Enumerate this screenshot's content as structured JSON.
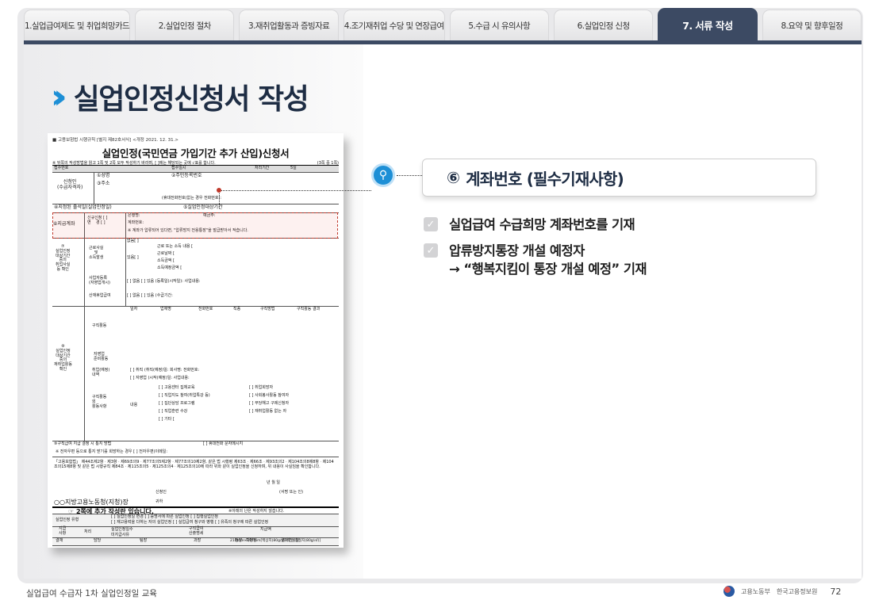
{
  "tabs": [
    {
      "label": "1.실업급여제도 및 취업희망카드"
    },
    {
      "label": "2.실업인정 절차"
    },
    {
      "label": "3.재취업활동과 증빙자료"
    },
    {
      "label": "4.조기재취업 수당 및 연장급여"
    },
    {
      "label": "5.수급 시 유의사항"
    },
    {
      "label": "6.실업인정 신청"
    },
    {
      "label": "7. 서류 작성",
      "active": true
    },
    {
      "label": "8.요약 및 향후일정"
    }
  ],
  "page_title": "실업인정신청서 작성",
  "form": {
    "header_note": "■ 고용보험법 시행규칙 [별지 제82호서식] <개정 2021. 12. 31.>",
    "title": "실업인정(국민연금 가입기간 추가 산입)신청서",
    "subnote": "※ 뒤쪽의 작성방법을 읽고 1쪽 및 2쪽 모두 작성하기 바라며, [ ]에는 해당되는 곳에 √표를 합니다.",
    "page_count": "(3쪽 중 1쪽)",
    "receipt_no": "접수번호",
    "receipt_date": "접수일시",
    "process_period_label": "처리기간",
    "process_period": "5일",
    "applicant": "신청인\n(수급자격자)",
    "name": "①성명",
    "resident_no": "②주민등록번호",
    "address": "③주소",
    "phone": "(휴대전화번호(없는 경우 전화번호):",
    "designated_date": "④지정된 출석일(실업인정일)",
    "period": "⑤실업인정대상기간",
    "account_label": "⑥지급계좌",
    "account_new": "신규신청 [ ]\n변    경 [ ]",
    "bank": "은행명:",
    "holder": "예금주:",
    "account_no": "계좌번호:",
    "account_note": "※ 계좌가 압류되어 있다면, \"압류방지 전용통장\"을 발급받아서 적습니다.",
    "section7": "⑦\n실업인정\n대상기간\n중의\n취업사실\n등 확인",
    "work_fact": "근로사실\n및\n소득발생",
    "none": "없음[ ]",
    "yes": "있음[ ]",
    "work_items": [
      "근로 또는 소득 내용 [",
      "근로날짜 [",
      "소득금액 [",
      "소득예정금액 ["
    ],
    "business_reg": "사업자등록\n(자영업개시)",
    "business_opts": "[ ] 없음  [ ] 있음 (등록일(시작일):        사업내용:",
    "industrial": "산재휴업급여",
    "industrial_opts": "[ ] 없음  [ ] 있음 (수급기간:",
    "section8": "⑧\n실업인정\n대상기간\n중의\n재취업활동\n확인",
    "job_search": "구직활동",
    "job_cols": [
      "일자",
      "업체명",
      "전화번호",
      "직종",
      "구직방법",
      "구직활동 결과"
    ],
    "self_emp": "자영업\n준비활동",
    "employment": "취업(예정)\n내역",
    "employment_opts": [
      "[ ] 취직 (취직(예정)일:     회사명:      전화번호:",
      "[ ] 자영업 (시작(예정)일:     사업내용:"
    ],
    "other_activity": "구직활동\n외\n활동사항",
    "content_label": "내용",
    "activity_opts": [
      "[ ] 고용센터 집체교육",
      "[ ] 직업지도 참여(취업특강 등)",
      "[ ] 집단상담 프로그램",
      "[ ] 직업훈련 수강",
      "[ ] 기타 ["
    ],
    "activity_opts2": [
      "[ ] 취업희망자",
      "[ ] 사회봉사활동 참여자",
      "[ ] 부당해고 구제신청자",
      "[ ] 재취업활동 없는 자"
    ],
    "notify_label": "⑨구직급여 지급 결정 시 통지 방법",
    "notify_opts": "[ ] 휴대전화 문자메시지",
    "notify_mail": "※ 전자우편 등으로 통지 받기를 희망하는 경우  [ ] 전자우편(이메일:",
    "law_text": "「고용보험법」 제44조제2항ㆍ제3항ㆍ제69조의9ㆍ제77조의5제2항ㆍ제77조의10제2항, 같은 법 시행령 제63조ㆍ제66조ㆍ제93조의2ㆍ제104조의8제8항ㆍ제104조의15제8항 및 같은 법 시행규칙 제84조ㆍ제115조의5ㆍ제125조의4ㆍ제125조의10에 따라 위와 같이 실업인정을 신청하며, 위 내용이 사실임을 확인합니다.",
    "date_line": "년      월      일",
    "signer": "신청인",
    "sign_note": "(서명 또는 인)",
    "office": "○○지방고용노동청(지청)장",
    "office_suffix": "귀하",
    "page2_note": "☞ 2쪽에 추가 작성란 있습니다.",
    "not_fill": "※아래의 난은 작성하지 않습니다.",
    "type_label": "실업인정 유형",
    "type_opts": "[ ] 실업인정일 변경   [ ] 증명서에 따른 실업인정   [ ] 집행실업인정",
    "type_opts2": "[ ] 재고용력을 다하는 자의 실업인정  [ ] 실업급여 청구와 병행  [ ] 유족의 청구에 따른 실업인정",
    "pay_label": "지급\n사항",
    "process": "처리",
    "days": "실업인정일수",
    "calc": "구직급여\n산출명세",
    "amount": "지급액",
    "unpaid": "미지급사유",
    "approval": "결재",
    "approval_cols": [
      "담당",
      "팀장",
      "과장",
      "청장ㆍ지청장",
      "결재연월일"
    ],
    "paper_size": "210mm×297mm[백상지(80g/㎡) 또는 중질지(80g/㎡)]"
  },
  "callout": {
    "number": "⑥",
    "label": "계좌번호 (필수기재사항)"
  },
  "bullets": [
    {
      "lines": [
        "실업급여 수급희망 계좌번호를 기재"
      ]
    },
    {
      "lines": [
        "압류방지통장 개설 예정자",
        "→ “행복지킴이 통장 개설 예정” 기재"
      ]
    }
  ],
  "footer": {
    "left": "실업급여 수급자 1차 실업인정일 교육",
    "org1": "고용노동부",
    "org2": "한국고용정보원",
    "page": "72"
  },
  "colors": {
    "active_tab": "#3c4a63",
    "accent": "#1d8fd6",
    "highlight": "#c0392b"
  }
}
